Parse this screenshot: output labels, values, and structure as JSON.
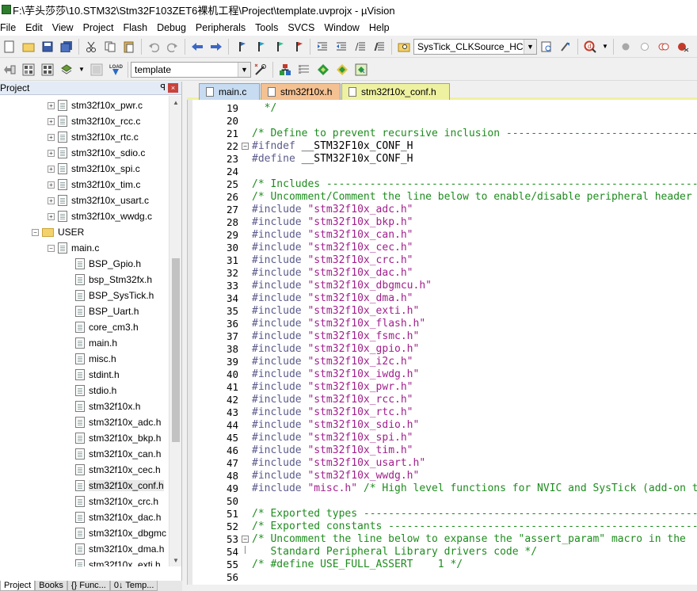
{
  "window": {
    "title": "F:\\芋头莎莎\\10.STM32\\Stm32F103ZET6裸机工程\\Project\\template.uvprojx - µVision"
  },
  "menu": [
    "File",
    "Edit",
    "View",
    "Project",
    "Flash",
    "Debug",
    "Peripherals",
    "Tools",
    "SVCS",
    "Window",
    "Help"
  ],
  "toolbar1": {
    "find_combo_value": "SysTick_CLKSource_HCLK"
  },
  "toolbar2": {
    "target_combo_value": "template"
  },
  "project_panel": {
    "title": "Project",
    "pin": "ᵖ",
    "close": "×",
    "tree": [
      {
        "label": "stm32f10x_pwr.c",
        "type": "cfile",
        "indent": 3,
        "expandable": true
      },
      {
        "label": "stm32f10x_rcc.c",
        "type": "cfile",
        "indent": 3,
        "expandable": true
      },
      {
        "label": "stm32f10x_rtc.c",
        "type": "cfile",
        "indent": 3,
        "expandable": true
      },
      {
        "label": "stm32f10x_sdio.c",
        "type": "cfile",
        "indent": 3,
        "expandable": true
      },
      {
        "label": "stm32f10x_spi.c",
        "type": "cfile",
        "indent": 3,
        "expandable": true
      },
      {
        "label": "stm32f10x_tim.c",
        "type": "cfile",
        "indent": 3,
        "expandable": true
      },
      {
        "label": "stm32f10x_usart.c",
        "type": "cfile",
        "indent": 3,
        "expandable": true
      },
      {
        "label": "stm32f10x_wwdg.c",
        "type": "cfile",
        "indent": 3,
        "expandable": true
      },
      {
        "label": "USER",
        "type": "folder",
        "indent": 2,
        "expandable": true,
        "expanded": true
      },
      {
        "label": "main.c",
        "type": "cfile",
        "indent": 3,
        "expandable": true,
        "expanded": true
      },
      {
        "label": "BSP_Gpio.h",
        "type": "hfile",
        "indent": 4
      },
      {
        "label": "bsp_Stm32fx.h",
        "type": "hfile",
        "indent": 4
      },
      {
        "label": "BSP_SysTick.h",
        "type": "hfile",
        "indent": 4
      },
      {
        "label": "BSP_Uart.h",
        "type": "hfile",
        "indent": 4
      },
      {
        "label": "core_cm3.h",
        "type": "hfile",
        "indent": 4
      },
      {
        "label": "main.h",
        "type": "hfile",
        "indent": 4
      },
      {
        "label": "misc.h",
        "type": "hfile",
        "indent": 4
      },
      {
        "label": "stdint.h",
        "type": "hfile",
        "indent": 4
      },
      {
        "label": "stdio.h",
        "type": "hfile",
        "indent": 4
      },
      {
        "label": "stm32f10x.h",
        "type": "hfile",
        "indent": 4
      },
      {
        "label": "stm32f10x_adc.h",
        "type": "hfile",
        "indent": 4
      },
      {
        "label": "stm32f10x_bkp.h",
        "type": "hfile",
        "indent": 4
      },
      {
        "label": "stm32f10x_can.h",
        "type": "hfile",
        "indent": 4
      },
      {
        "label": "stm32f10x_cec.h",
        "type": "hfile",
        "indent": 4
      },
      {
        "label": "stm32f10x_conf.h",
        "type": "hfile",
        "indent": 4,
        "selected": true
      },
      {
        "label": "stm32f10x_crc.h",
        "type": "hfile",
        "indent": 4
      },
      {
        "label": "stm32f10x_dac.h",
        "type": "hfile",
        "indent": 4
      },
      {
        "label": "stm32f10x_dbgmc",
        "type": "hfile",
        "indent": 4
      },
      {
        "label": "stm32f10x_dma.h",
        "type": "hfile",
        "indent": 4
      },
      {
        "label": "stm32f10x_exti.h",
        "type": "hfile",
        "indent": 4
      }
    ],
    "bottom_tabs": [
      "Project",
      "Books",
      "{} Func...",
      "0↓ Temp..."
    ]
  },
  "editor": {
    "tabs": [
      {
        "label": "main.c",
        "color": "#c7dbf1"
      },
      {
        "label": "stm32f10x.h",
        "color": "#f4c192"
      },
      {
        "label": "stm32f10x_conf.h",
        "color": "#eef1a0",
        "active": true
      }
    ],
    "lines": [
      {
        "n": "19",
        "parts": [
          {
            "t": "  */",
            "c": "cm"
          }
        ]
      },
      {
        "n": "20",
        "parts": []
      },
      {
        "n": "21",
        "parts": [
          {
            "t": "/* Define to prevent recursive inclusion -------------------------------------",
            "c": "cm"
          }
        ]
      },
      {
        "n": "22",
        "fold": "minus",
        "parts": [
          {
            "t": "#ifndef ",
            "c": "pp"
          },
          {
            "t": "__STM32F10x_CONF_H",
            "c": ""
          }
        ]
      },
      {
        "n": "23",
        "parts": [
          {
            "t": "#define ",
            "c": "pp"
          },
          {
            "t": "__STM32F10x_CONF_H",
            "c": ""
          }
        ]
      },
      {
        "n": "24",
        "parts": []
      },
      {
        "n": "25",
        "parts": [
          {
            "t": "/* Includes ------------------------------------------------------------------",
            "c": "cm"
          }
        ]
      },
      {
        "n": "26",
        "parts": [
          {
            "t": "/* Uncomment/Comment the line below to enable/disable peripheral header file inc",
            "c": "cm"
          }
        ]
      },
      {
        "n": "27",
        "parts": [
          {
            "t": "#include ",
            "c": "pp"
          },
          {
            "t": "\"stm32f10x_adc.h\"",
            "c": "st"
          }
        ]
      },
      {
        "n": "28",
        "parts": [
          {
            "t": "#include ",
            "c": "pp"
          },
          {
            "t": "\"stm32f10x_bkp.h\"",
            "c": "st"
          }
        ]
      },
      {
        "n": "29",
        "parts": [
          {
            "t": "#include ",
            "c": "pp"
          },
          {
            "t": "\"stm32f10x_can.h\"",
            "c": "st"
          }
        ]
      },
      {
        "n": "30",
        "parts": [
          {
            "t": "#include ",
            "c": "pp"
          },
          {
            "t": "\"stm32f10x_cec.h\"",
            "c": "st"
          }
        ]
      },
      {
        "n": "31",
        "parts": [
          {
            "t": "#include ",
            "c": "pp"
          },
          {
            "t": "\"stm32f10x_crc.h\"",
            "c": "st"
          }
        ]
      },
      {
        "n": "32",
        "parts": [
          {
            "t": "#include ",
            "c": "pp"
          },
          {
            "t": "\"stm32f10x_dac.h\"",
            "c": "st"
          }
        ]
      },
      {
        "n": "33",
        "parts": [
          {
            "t": "#include ",
            "c": "pp"
          },
          {
            "t": "\"stm32f10x_dbgmcu.h\"",
            "c": "st"
          }
        ]
      },
      {
        "n": "34",
        "parts": [
          {
            "t": "#include ",
            "c": "pp"
          },
          {
            "t": "\"stm32f10x_dma.h\"",
            "c": "st"
          }
        ]
      },
      {
        "n": "35",
        "parts": [
          {
            "t": "#include ",
            "c": "pp"
          },
          {
            "t": "\"stm32f10x_exti.h\"",
            "c": "st"
          }
        ]
      },
      {
        "n": "36",
        "parts": [
          {
            "t": "#include ",
            "c": "pp"
          },
          {
            "t": "\"stm32f10x_flash.h\"",
            "c": "st"
          }
        ]
      },
      {
        "n": "37",
        "parts": [
          {
            "t": "#include ",
            "c": "pp"
          },
          {
            "t": "\"stm32f10x_fsmc.h\"",
            "c": "st"
          }
        ]
      },
      {
        "n": "38",
        "parts": [
          {
            "t": "#include ",
            "c": "pp"
          },
          {
            "t": "\"stm32f10x_gpio.h\"",
            "c": "st"
          }
        ]
      },
      {
        "n": "39",
        "parts": [
          {
            "t": "#include ",
            "c": "pp"
          },
          {
            "t": "\"stm32f10x_i2c.h\"",
            "c": "st"
          }
        ]
      },
      {
        "n": "40",
        "parts": [
          {
            "t": "#include ",
            "c": "pp"
          },
          {
            "t": "\"stm32f10x_iwdg.h\"",
            "c": "st"
          }
        ]
      },
      {
        "n": "41",
        "parts": [
          {
            "t": "#include ",
            "c": "pp"
          },
          {
            "t": "\"stm32f10x_pwr.h\"",
            "c": "st"
          }
        ]
      },
      {
        "n": "42",
        "parts": [
          {
            "t": "#include ",
            "c": "pp"
          },
          {
            "t": "\"stm32f10x_rcc.h\"",
            "c": "st"
          }
        ]
      },
      {
        "n": "43",
        "parts": [
          {
            "t": "#include ",
            "c": "pp"
          },
          {
            "t": "\"stm32f10x_rtc.h\"",
            "c": "st"
          }
        ]
      },
      {
        "n": "44",
        "parts": [
          {
            "t": "#include ",
            "c": "pp"
          },
          {
            "t": "\"stm32f10x_sdio.h\"",
            "c": "st"
          }
        ]
      },
      {
        "n": "45",
        "parts": [
          {
            "t": "#include ",
            "c": "pp"
          },
          {
            "t": "\"stm32f10x_spi.h\"",
            "c": "st"
          }
        ]
      },
      {
        "n": "46",
        "parts": [
          {
            "t": "#include ",
            "c": "pp"
          },
          {
            "t": "\"stm32f10x_tim.h\"",
            "c": "st"
          }
        ]
      },
      {
        "n": "47",
        "parts": [
          {
            "t": "#include ",
            "c": "pp"
          },
          {
            "t": "\"stm32f10x_usart.h\"",
            "c": "st"
          }
        ]
      },
      {
        "n": "48",
        "parts": [
          {
            "t": "#include ",
            "c": "pp"
          },
          {
            "t": "\"stm32f10x_wwdg.h\"",
            "c": "st"
          }
        ]
      },
      {
        "n": "49",
        "parts": [
          {
            "t": "#include ",
            "c": "pp"
          },
          {
            "t": "\"misc.h\"",
            "c": "st"
          },
          {
            "t": " /* High level functions for NVIC and SysTick (add-on to CMSIS",
            "c": "cm"
          }
        ]
      },
      {
        "n": "50",
        "parts": []
      },
      {
        "n": "51",
        "parts": [
          {
            "t": "/* Exported types ------------------------------------------------------------",
            "c": "cm"
          }
        ]
      },
      {
        "n": "52",
        "parts": [
          {
            "t": "/* Exported constants --------------------------------------------------------",
            "c": "cm"
          }
        ]
      },
      {
        "n": "53",
        "fold": "minus",
        "parts": [
          {
            "t": "/* Uncomment the line below to expanse the \"assert_param\" macro in the",
            "c": "cm"
          }
        ]
      },
      {
        "n": "54",
        "fold": "line",
        "parts": [
          {
            "t": "   Standard Peripheral Library drivers code */",
            "c": "cm"
          }
        ]
      },
      {
        "n": "55",
        "parts": [
          {
            "t": "/* #define USE_FULL_ASSERT    1 */",
            "c": "cm"
          }
        ]
      },
      {
        "n": "56",
        "parts": []
      }
    ]
  }
}
